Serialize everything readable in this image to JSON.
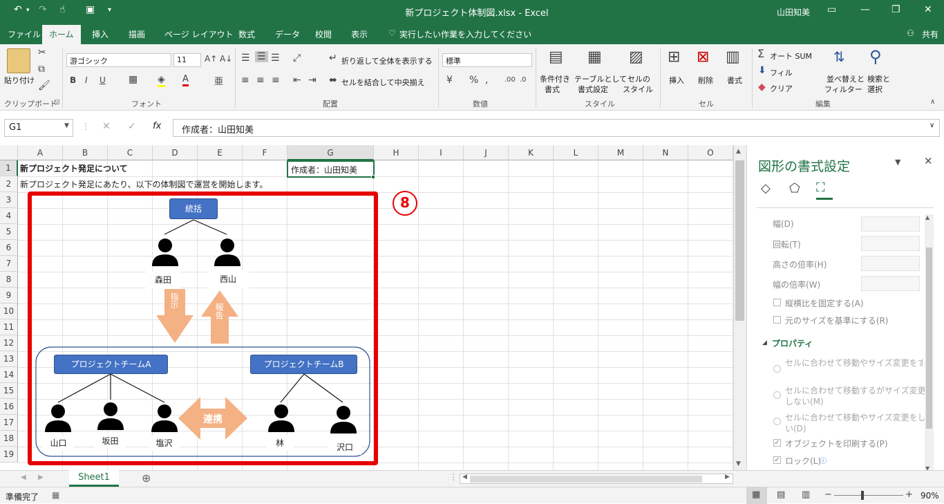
{
  "window": {
    "title": "新プロジェクト体制図.xlsx  -  Excel",
    "user": "山田知美"
  },
  "tabs": [
    "ファイル",
    "ホーム",
    "挿入",
    "描画",
    "ページ レイアウト",
    "数式",
    "データ",
    "校閲",
    "表示"
  ],
  "active_tab": "ホーム",
  "tell_me": "実行したい作業を入力してください",
  "share": "共有",
  "ribbon": {
    "clipboard": {
      "paste": "貼り付け",
      "group": "クリップボード"
    },
    "font": {
      "name": "游ゴシック",
      "size": "11",
      "bold": "B",
      "italic": "I",
      "underline": "U",
      "group": "フォント"
    },
    "alignment": {
      "wrap": "折り返して全体を表示する",
      "merge": "セルを結合して中央揃え",
      "group": "配置"
    },
    "number": {
      "format": "標準",
      "percent": "%",
      "group": "数値"
    },
    "styles": {
      "conditional_1": "条件付き",
      "conditional_2": "書式",
      "table_1": "テーブルとして",
      "table_2": "書式設定",
      "cell_1": "セルの",
      "cell_2": "スタイル",
      "group": "スタイル"
    },
    "cells": {
      "insert": "挿入",
      "delete": "削除",
      "format": "書式",
      "group": "セル"
    },
    "editing": {
      "autosum": "オート SUM",
      "fill": "フィル",
      "clear": "クリア",
      "sort_1": "並べ替えと",
      "sort_2": "フィルター",
      "find_1": "検索と",
      "find_2": "選択",
      "group": "編集"
    }
  },
  "formula_bar": {
    "name_box": "G1",
    "fx": "fx",
    "content": "作成者：山田知美"
  },
  "columns": [
    "A",
    "B",
    "C",
    "D",
    "E",
    "F",
    "G",
    "H",
    "I",
    "J",
    "K",
    "L",
    "M",
    "N",
    "O"
  ],
  "rows": [
    "1",
    "2",
    "3",
    "4",
    "5",
    "6",
    "7",
    "8",
    "9",
    "10",
    "11",
    "12",
    "13",
    "14",
    "15",
    "16",
    "17",
    "18",
    "19"
  ],
  "cells": {
    "a1": "新プロジェクト発足について",
    "a2": "新プロジェクト発足にあたり、以下の体制図で運営を開始します。",
    "g1": "作成者：山田知美"
  },
  "chart_data": {
    "type": "org",
    "step_badge": "8",
    "top": "統括",
    "managers": [
      "森田",
      "西山"
    ],
    "arrow_down": "指示",
    "arrow_up": "報告",
    "team_a": {
      "label": "プロジェクトチームA",
      "members": [
        "山口",
        "坂田",
        "塩沢"
      ]
    },
    "team_b": {
      "label": "プロジェクトチームB",
      "members": [
        "林",
        "沢口"
      ]
    },
    "link": "連携"
  },
  "pane": {
    "title": "図形の書式設定",
    "fields": [
      "幅(D)",
      "回転(T)",
      "高さの倍率(H)",
      "幅の倍率(W)"
    ],
    "lock_ratio": "縦横比を固定する(A)",
    "relative_orig": "元のサイズを基準にする(R)",
    "properties": "プロパティ",
    "radio_1": "セルに合わせて移動やサイズ変更をする(S)",
    "radio_2a": "セルに合わせて移動するがサイズ変更は",
    "radio_2b": "しない(M)",
    "radio_3a": "セルに合わせて移動やサイズ変更をしな",
    "radio_3b": "い(D)",
    "print_obj": "オブジェクトを印刷する(P)",
    "lock": "ロック(L)"
  },
  "sheet_tab": "Sheet1",
  "status": {
    "ready": "準備完了",
    "zoom": "90%"
  },
  "colors": {
    "excel_green": "#217346",
    "accent_red": "#e60000",
    "box_blue": "#4472c4",
    "arrow_orange": "#f4b183"
  }
}
